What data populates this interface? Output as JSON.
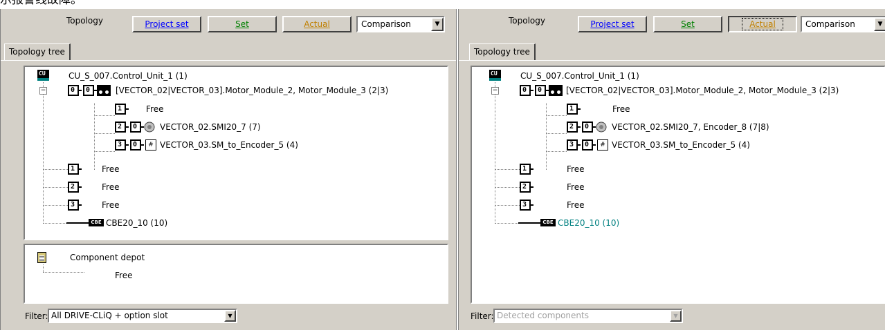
{
  "caption": "示报警线故障。",
  "left": {
    "toolbar": {
      "topology_label": "Topology",
      "project_set": "Project set",
      "set": "Set",
      "actual": "Actual",
      "view_select": "Comparison"
    },
    "tab": "Topology tree",
    "tree": {
      "control_unit": "CU_S_007.Control_Unit_1 (1)",
      "cu_icon_text": "CU",
      "motor_module": "[VECTOR_02|VECTOR_03].Motor_Module_2, Motor_Module_3 (2|3)",
      "mm_free": "Free",
      "smi20": "VECTOR_02.SMI20_7 (7)",
      "sm_encoder": "VECTOR_03.SM_to_Encoder_5 (4)",
      "free1": "Free",
      "free2": "Free",
      "free3": "Free",
      "cbe20": "CBE20_10 (10)",
      "cbe_icon_text": "CBE",
      "port_labels": [
        "0",
        "0",
        "1",
        "2",
        "0",
        "3",
        "0",
        "1",
        "2",
        "3"
      ]
    },
    "depot": {
      "title": "Component depot",
      "free": "Free"
    },
    "filter": {
      "label": "Filter:",
      "value": "All DRIVE-CLiQ + option slot"
    }
  },
  "right": {
    "toolbar": {
      "topology_label": "Topology",
      "project_set": "Project set",
      "set": "Set",
      "actual": "Actual",
      "view_select": "Comparison"
    },
    "tab": "Topology tree",
    "tree": {
      "control_unit": "CU_S_007.Control_Unit_1 (1)",
      "cu_icon_text": "CU",
      "motor_module": "[VECTOR_02|VECTOR_03].Motor_Module_2, Motor_Module_3 (2|3)",
      "mm_free": "Free",
      "smi20": "VECTOR_02.SMI20_7, Encoder_8 (7|8)",
      "sm_encoder": "VECTOR_03.SM_to_Encoder_5 (4)",
      "free1": "Free",
      "free2": "Free",
      "free3": "Free",
      "cbe20": "CBE20_10 (10)",
      "cbe_icon_text": "CBE",
      "port_labels": [
        "0",
        "0",
        "1",
        "2",
        "0",
        "3",
        "0",
        "1",
        "2",
        "3"
      ]
    },
    "filter": {
      "label": "Filter:",
      "value": "Detected components"
    }
  },
  "colors": {
    "dialog_bg": "#d4d0c8",
    "link_blue": "#0000ff",
    "set_green": "#008000",
    "actual_gold": "#c08000",
    "cbe_teal": "#008080"
  }
}
